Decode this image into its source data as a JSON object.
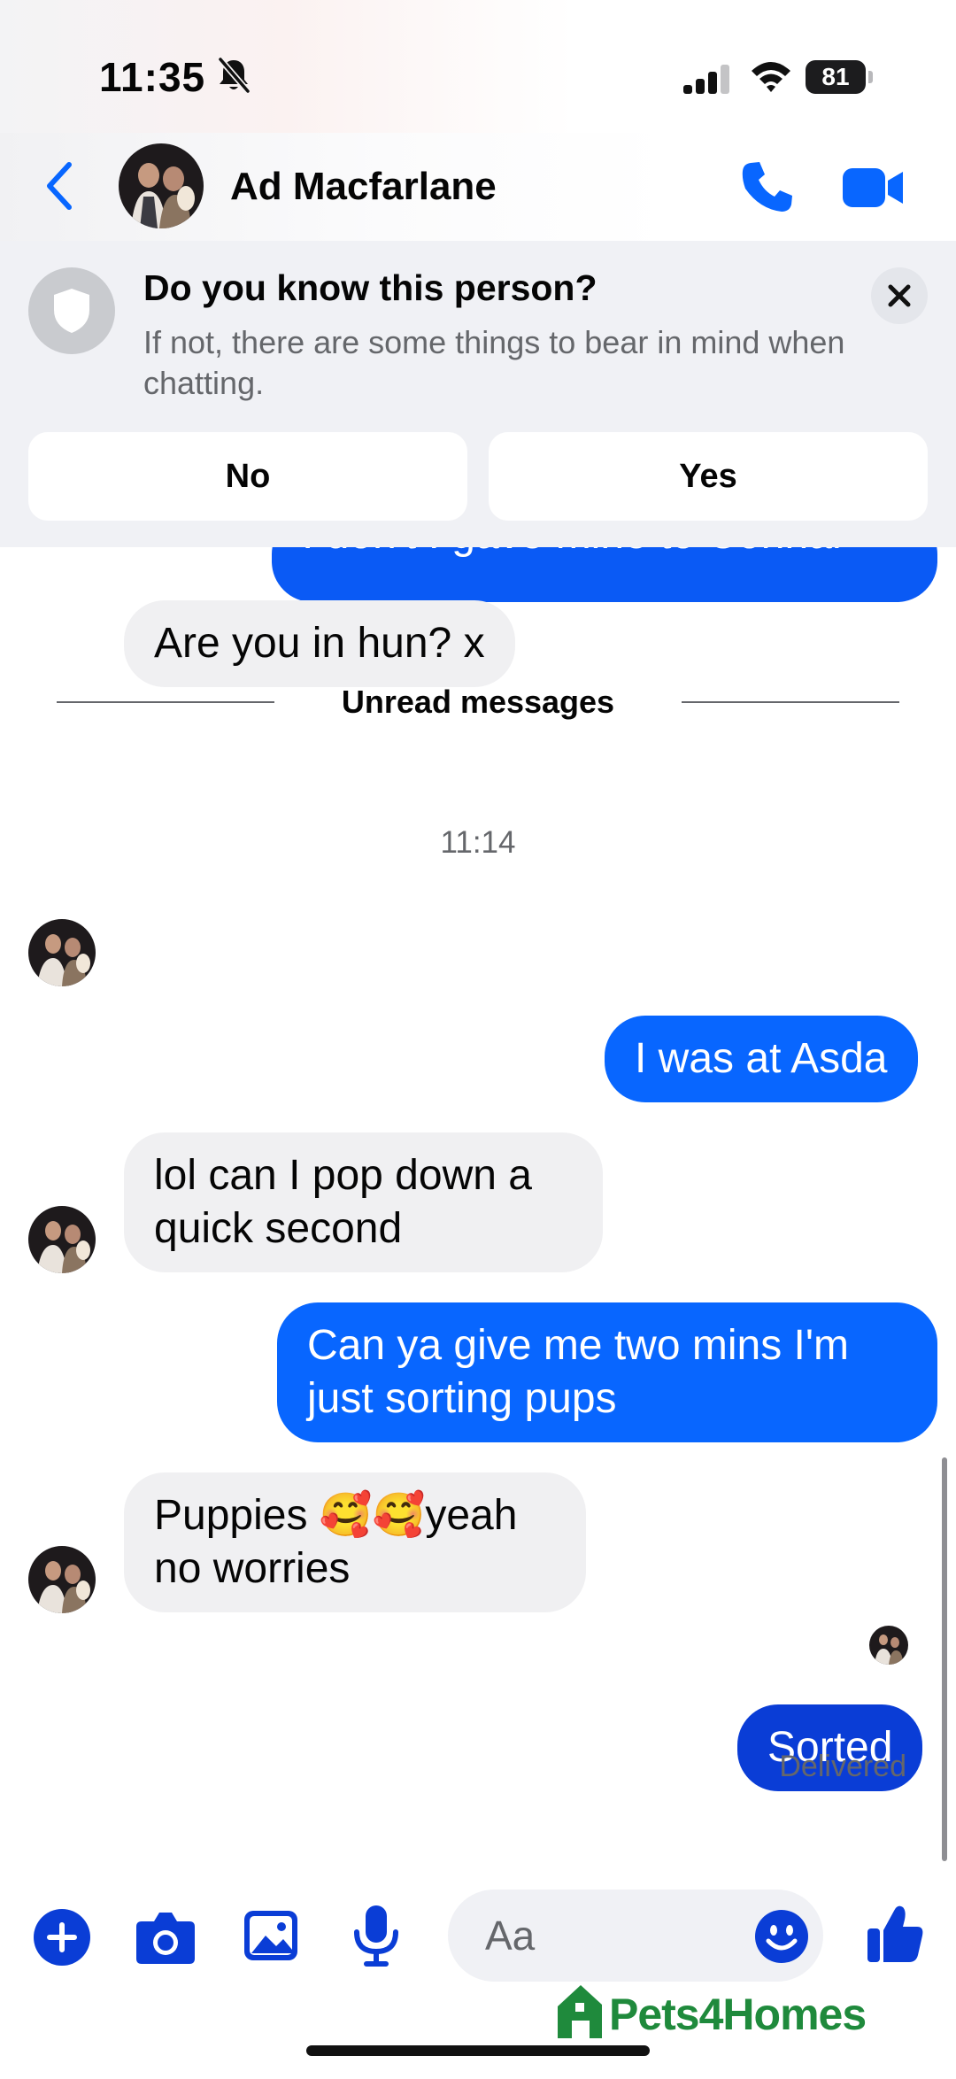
{
  "status_bar": {
    "time": "11:35",
    "battery": "81"
  },
  "header": {
    "contact_name": "Ad Macfarlane"
  },
  "banner": {
    "title": "Do you know this person?",
    "text": "If not, there are some things to bear in mind when chatting.",
    "no_label": "No",
    "yes_label": "Yes"
  },
  "chat": {
    "partial_top_message": "I don't I gave  mine to Connar",
    "unread_label": "Unread messages",
    "timestamp": "11:14",
    "messages": [
      {
        "side": "in",
        "text": "Are you in hun? x"
      },
      {
        "side": "out",
        "text": "I was at Asda"
      },
      {
        "side": "in",
        "text": "lol can I pop down a quick second"
      },
      {
        "side": "out",
        "text": "Can ya give me two mins I'm just sorting pups"
      },
      {
        "side": "in",
        "text": "Puppies 🥰🥰yeah no worries"
      },
      {
        "side": "out",
        "text": "Sorted"
      }
    ],
    "delivered_label": "Delivered"
  },
  "composer": {
    "placeholder": "Aa"
  },
  "watermark": {
    "text": "Pets4Homes"
  },
  "colors": {
    "messenger_blue": "#0866ff",
    "icon_blue": "#0a3dd6",
    "incoming_bubble": "#f0f0f2",
    "secondary_text": "#65676b",
    "watermark_green": "#1f8a3c"
  },
  "icons": [
    "bell-off-icon",
    "signal-icon",
    "wifi-icon",
    "back-icon",
    "phone-icon",
    "video-icon",
    "shield-icon",
    "close-icon",
    "plus-icon",
    "camera-icon",
    "gallery-icon",
    "mic-icon",
    "emoji-icon",
    "like-icon"
  ]
}
